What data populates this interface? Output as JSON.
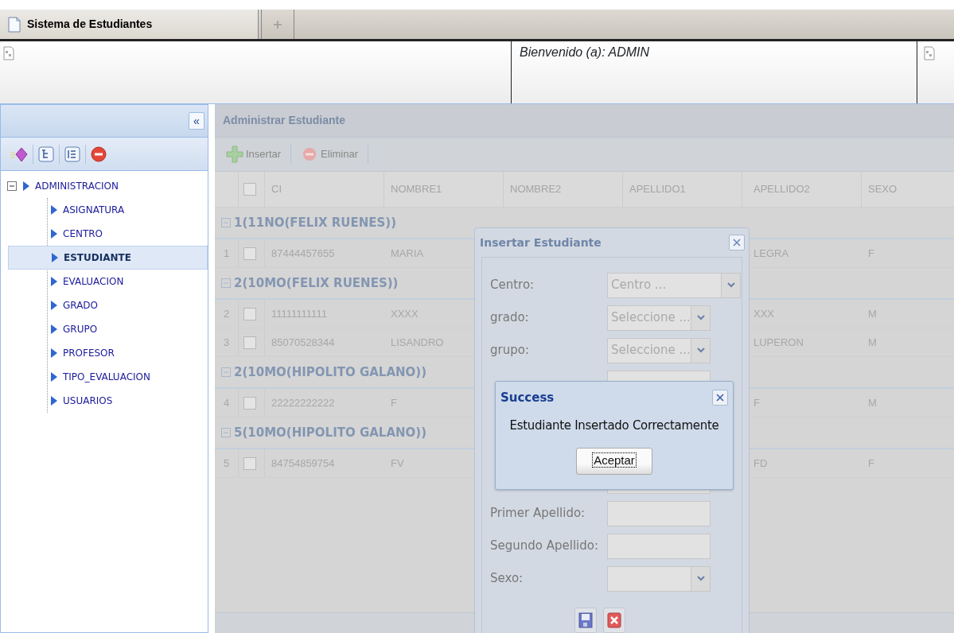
{
  "tabs": [
    {
      "label": "Sistema de Estudiantes",
      "selected": true
    }
  ],
  "header": {
    "welcome": "Bienvenido (a): ADMIN"
  },
  "sidebar": {
    "collapse_button": "«",
    "tree": [
      {
        "label": "ADMINISTRACION",
        "expanded": true,
        "selected": false,
        "children": [
          {
            "label": "ASIGNATURA",
            "selected": false
          },
          {
            "label": "CENTRO",
            "selected": false
          },
          {
            "label": "ESTUDIANTE",
            "selected": true
          },
          {
            "label": "EVALUACION",
            "selected": false
          },
          {
            "label": "GRADO",
            "selected": false
          },
          {
            "label": "GRUPO",
            "selected": false
          },
          {
            "label": "PROFESOR",
            "selected": false
          },
          {
            "label": "TIPO_EVALUACION",
            "selected": false
          },
          {
            "label": "USUARIOS",
            "selected": false
          }
        ]
      }
    ]
  },
  "panel": {
    "title": "Administrar Estudiante",
    "toolbar": [
      {
        "label": "Insertar",
        "kind": "add"
      },
      {
        "label": "Eliminar",
        "kind": "delete"
      }
    ]
  },
  "table": {
    "header_checked": false,
    "columns": [
      "CI",
      "NOMBRE1",
      "NOMBRE2",
      "APELLIDO1",
      "APELLIDO2",
      "SEXO"
    ],
    "groups": [
      {
        "label": "1(11NO(FELIX RUENES))",
        "expanded": true,
        "rows": [
          {
            "number": "1",
            "checked": false,
            "ci": "87444457655",
            "nombre1": "MARIA",
            "apellido2": "LEGRA",
            "sexo": "F"
          }
        ]
      },
      {
        "label": "2(10MO(FELIX RUENES))",
        "expanded": true,
        "rows": [
          {
            "number": "2",
            "checked": false,
            "ci": "11111111111",
            "nombre1": "XXXX",
            "apellido2": "XXX",
            "sexo": "M"
          },
          {
            "number": "3",
            "checked": false,
            "ci": "85070528344",
            "nombre1": "LISANDRO",
            "apellido2": "LUPERON",
            "sexo": "M"
          }
        ]
      },
      {
        "label": "2(10MO(HIPOLITO GALANO))",
        "expanded": true,
        "rows": [
          {
            "number": "4",
            "checked": false,
            "ci": "22222222222",
            "nombre1": "F",
            "apellido2": "F",
            "sexo": "M"
          }
        ]
      },
      {
        "label": "5(10MO(HIPOLITO GALANO))",
        "expanded": true,
        "rows": [
          {
            "number": "5",
            "checked": false,
            "ci": "84754859754",
            "nombre1": "FV",
            "apellido2": "FD",
            "sexo": "F"
          }
        ]
      }
    ]
  },
  "insert_dialog": {
    "title": "Insertar Estudiante",
    "fields": [
      {
        "label": "Centro:",
        "kind": "select",
        "placeholder": "Centro ..."
      },
      {
        "label": "grado:",
        "kind": "select",
        "placeholder": "Seleccione ..."
      },
      {
        "label": "grupo:",
        "kind": "select",
        "placeholder": "Seleccione ..."
      },
      {
        "kind": "text"
      },
      {
        "kind": "text"
      },
      {
        "label": "Primer Apellido:",
        "kind": "text"
      },
      {
        "label": "Segundo Apellido:",
        "kind": "text"
      },
      {
        "label": "Sexo:",
        "kind": "select"
      }
    ]
  },
  "success_dialog": {
    "title": "Success",
    "message": "Estudiante Insertado Correctamente",
    "button": "Aceptar"
  }
}
